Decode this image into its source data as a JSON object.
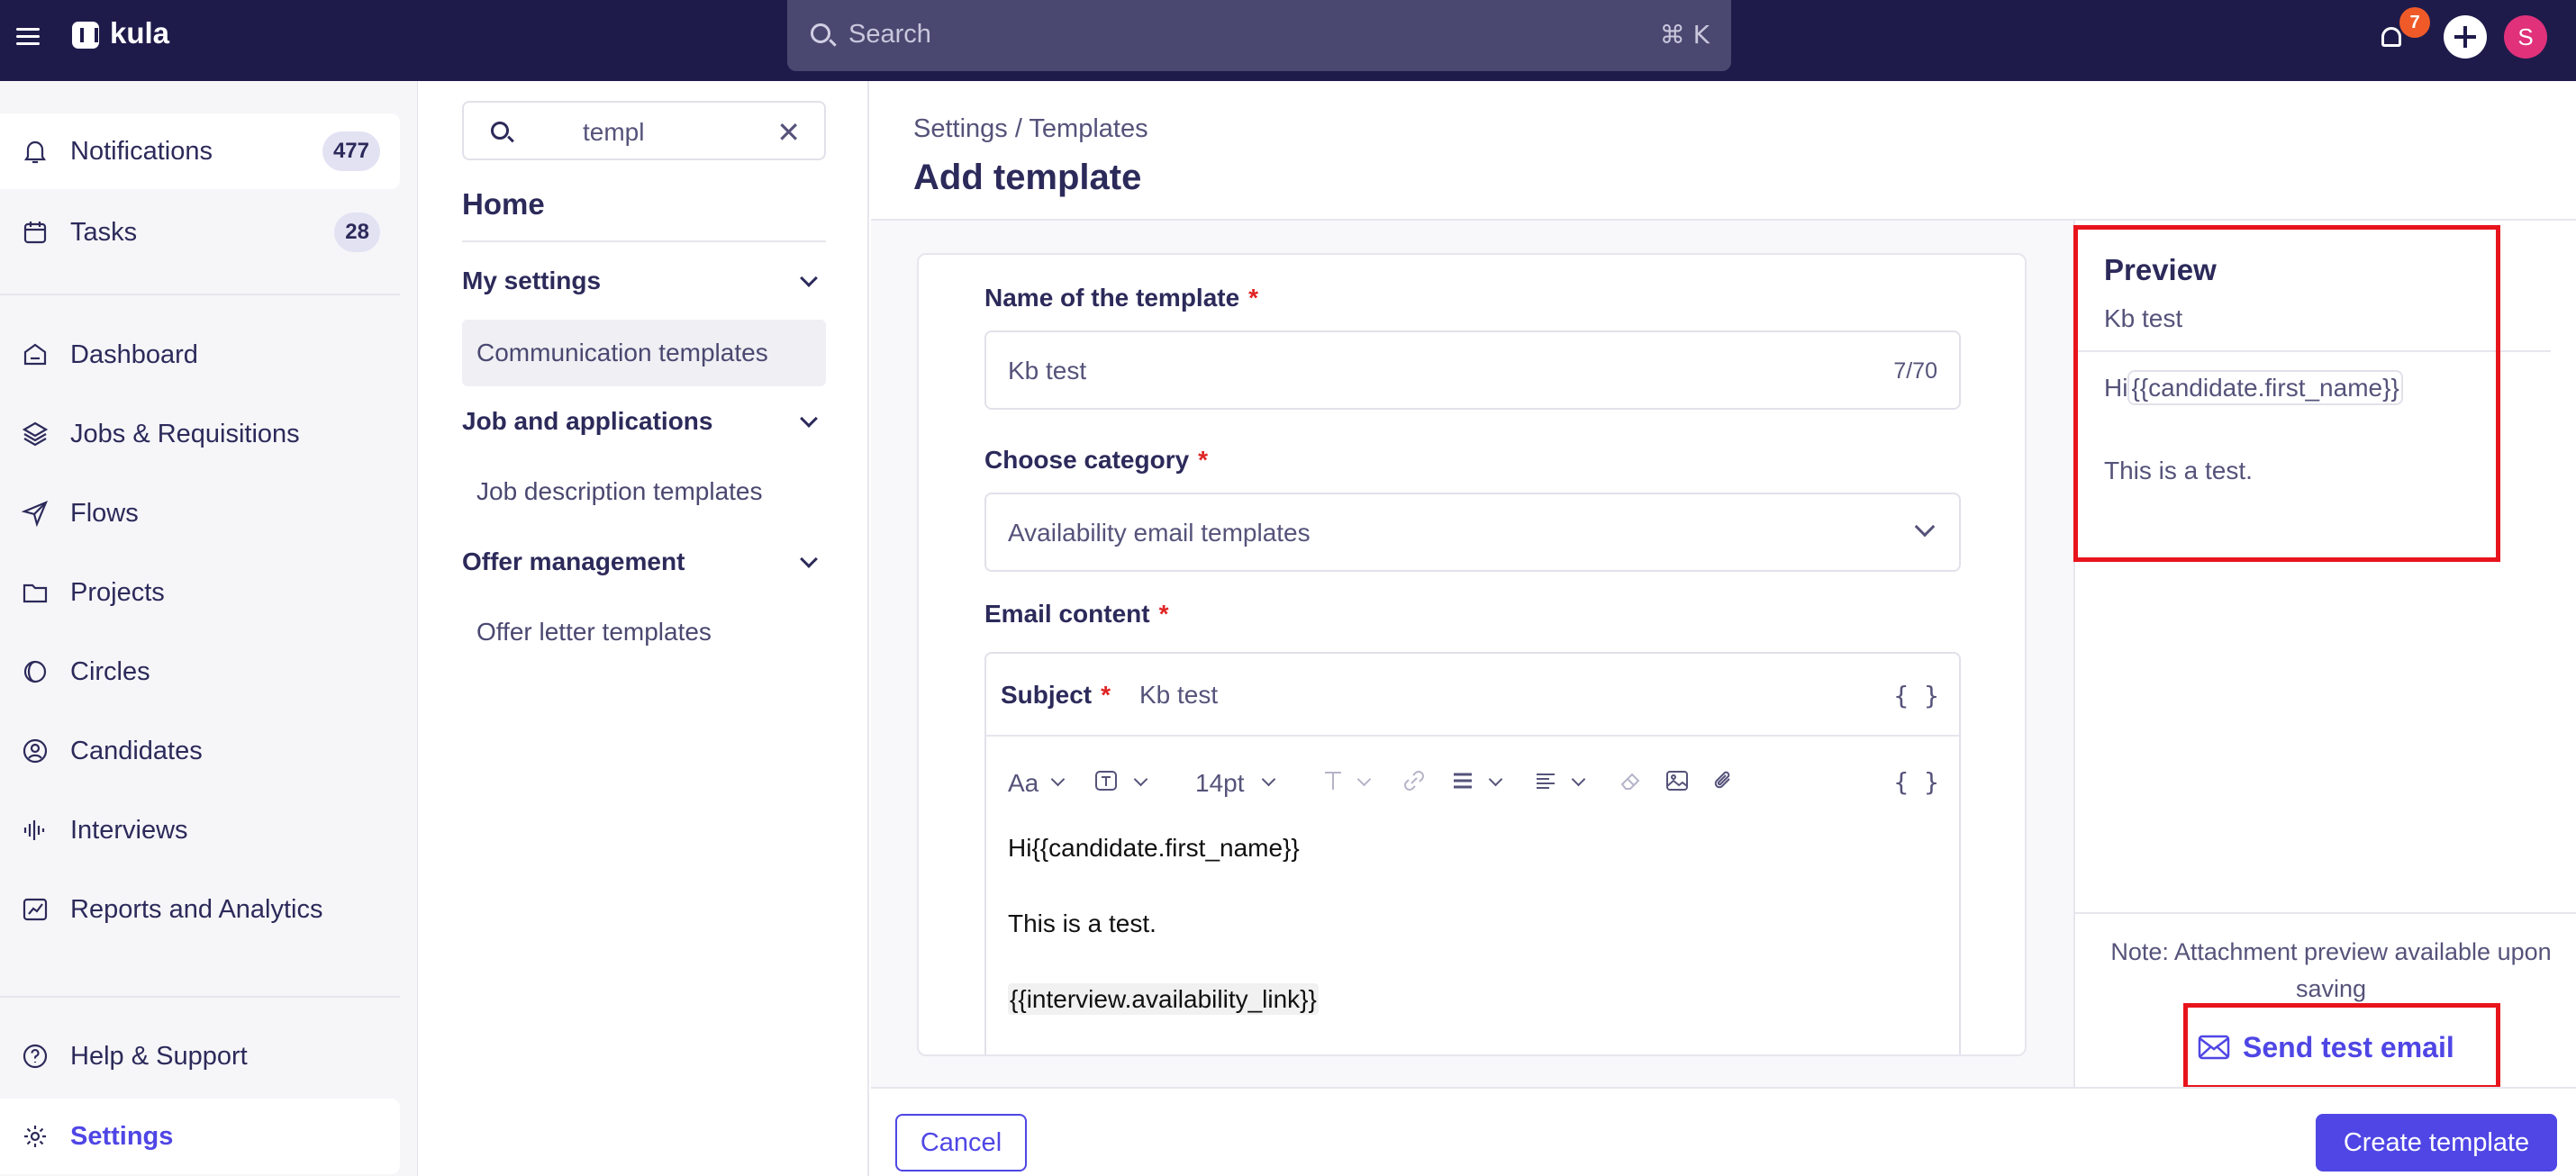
{
  "app": {
    "name": "kula",
    "search_placeholder": "Search",
    "search_shortcut": "⌘ K",
    "notification_badge": "7",
    "user_initial": "S"
  },
  "sidebar": {
    "top_items": [
      {
        "label": "Notifications",
        "count": "477",
        "icon": "bell-icon"
      },
      {
        "label": "Tasks",
        "count": "28",
        "icon": "calendar-icon"
      }
    ],
    "items": [
      {
        "label": "Dashboard",
        "icon": "home-icon"
      },
      {
        "label": "Jobs & Requisitions",
        "icon": "layers-icon"
      },
      {
        "label": "Flows",
        "icon": "send-icon"
      },
      {
        "label": "Projects",
        "icon": "folder-icon"
      },
      {
        "label": "Circles",
        "icon": "circles-icon"
      },
      {
        "label": "Candidates",
        "icon": "user-circle-icon"
      },
      {
        "label": "Interviews",
        "icon": "audio-bars-icon"
      },
      {
        "label": "Reports and Analytics",
        "icon": "chart-icon"
      }
    ],
    "bottom_items": [
      {
        "label": "Help & Support",
        "icon": "help-icon"
      },
      {
        "label": "Settings",
        "icon": "gear-icon"
      }
    ]
  },
  "subnav": {
    "search_value": "templ",
    "home": "Home",
    "groups": [
      {
        "title": "My settings",
        "links": [
          "Communication templates"
        ]
      },
      {
        "title": "Job and applications",
        "links": [
          "Job description templates"
        ]
      },
      {
        "title": "Offer management",
        "links": [
          "Offer letter templates"
        ]
      }
    ]
  },
  "main": {
    "breadcrumb": "Settings / Templates",
    "title": "Add template",
    "form": {
      "name_label": "Name of the template",
      "name_value": "Kb test",
      "name_counter": "7/70",
      "category_label": "Choose category",
      "category_value": "Availability email templates",
      "content_label": "Email content",
      "required_mark": "*",
      "subject_label": "Subject",
      "subject_value": "Kb test",
      "braces": "{ }",
      "toolbar": {
        "font": "Aa",
        "size": "14pt"
      },
      "body": {
        "line1": "Hi{{candidate.first_name}}",
        "line2": "This is a test.",
        "line3": "{{interview.availability_link}}"
      }
    }
  },
  "preview": {
    "title": "Preview",
    "subject": "Kb test",
    "greeting_prefix": "Hi",
    "greeting_token": "{{candidate.first_name}}",
    "body": "This is a test.",
    "note": "Note: Attachment preview available upon saving",
    "send_test_label": "Send test email"
  },
  "footer": {
    "cancel_label": "Cancel",
    "create_label": "Create template"
  },
  "colors": {
    "topbar": "#1e1b4b",
    "accent": "#4f46e5",
    "highlight_box": "#e8141c"
  }
}
